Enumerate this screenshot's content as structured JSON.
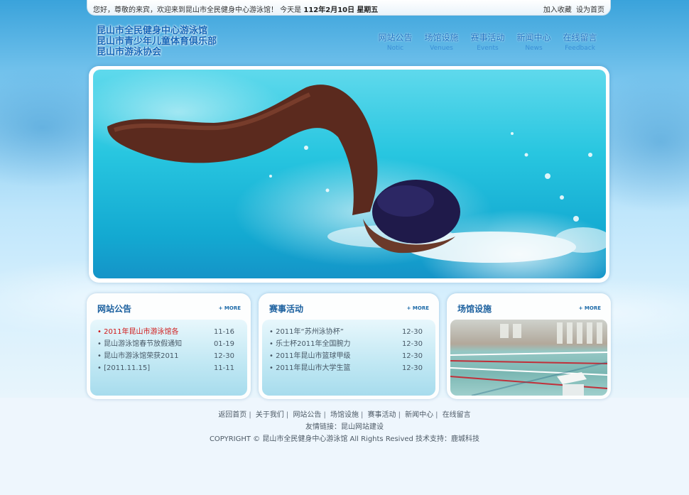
{
  "topbar": {
    "welcome_text": "您好，尊敬的来宾，欢迎来到昆山市全民健身中心游泳馆！ 今天是",
    "date": "112年2月10日",
    "weekday": "星期五",
    "links": [
      "加入收藏",
      "设为首页"
    ]
  },
  "logo": {
    "lines": [
      "昆山市全民健身中心游泳馆",
      "昆山市青少年儿童体育俱乐部",
      "昆山市游泳协会"
    ]
  },
  "nav": [
    {
      "cn": "网站公告",
      "en": "Notic"
    },
    {
      "cn": "场馆设施",
      "en": "Venues"
    },
    {
      "cn": "赛事活动",
      "en": "Events"
    },
    {
      "cn": "新闻中心",
      "en": "News"
    },
    {
      "cn": "在线留言",
      "en": "Feedback"
    }
  ],
  "boxes": {
    "notice": {
      "title": "网站公告",
      "more": "+ MORE",
      "items": [
        {
          "text": "• 2011年昆山市游泳馆各",
          "date": "11-16",
          "highlight": true
        },
        {
          "text": "• 昆山游泳馆春节放假通知",
          "date": "01-19"
        },
        {
          "text": "• 昆山市游泳馆荣获2011",
          "date": "12-30"
        },
        {
          "text": "• [2011.11.15]",
          "date": "11-11"
        }
      ]
    },
    "events": {
      "title": "赛事活动",
      "more": "+ MORE",
      "items": [
        {
          "text": "• 2011年“苏州泳协杯”",
          "date": "12-30"
        },
        {
          "text": "• 乐士杯2011年全国腕力",
          "date": "12-30"
        },
        {
          "text": "• 2011年昆山市篮球甲级",
          "date": "12-30"
        },
        {
          "text": "• 2011年昆山市大学生篮",
          "date": "12-30"
        }
      ]
    },
    "venues": {
      "title": "场馆设施",
      "more": "+ MORE"
    }
  },
  "footer": {
    "links": [
      "返回首页",
      "关于我们",
      "网站公告",
      "场馆设施",
      "赛事活动",
      "新闻中心",
      "在线留言"
    ],
    "friend_links": "友情链接：昆山网站建设",
    "copyright": "COPYRIGHT © 昆山市全民健身中心游泳馆 All Rights Resived 技术支持：鹿城科技"
  },
  "colors": {
    "accent": "#1466b8",
    "highlight": "#d01818"
  }
}
